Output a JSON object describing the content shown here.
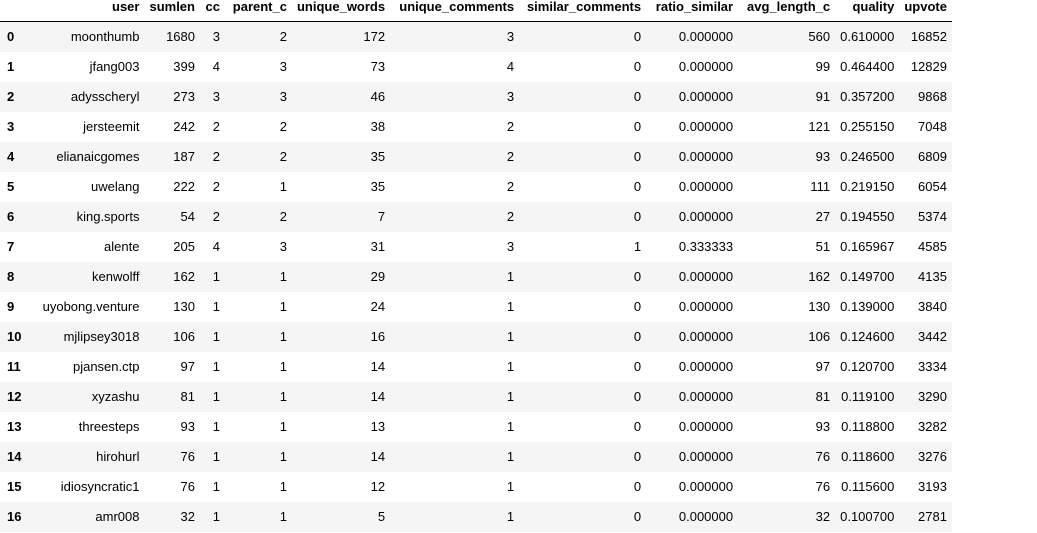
{
  "table": {
    "index_header": "",
    "columns": [
      "user",
      "sumlen",
      "cc",
      "parent_c",
      "unique_words",
      "unique_comments",
      "similar_comments",
      "ratio_similar",
      "avg_length_c",
      "quality",
      "upvote"
    ],
    "rows": [
      {
        "index": "0",
        "cells": [
          "moonthumb",
          "1680",
          "3",
          "2",
          "172",
          "3",
          "0",
          "0.000000",
          "560",
          "0.610000",
          "16852"
        ]
      },
      {
        "index": "1",
        "cells": [
          "jfang003",
          "399",
          "4",
          "3",
          "73",
          "4",
          "0",
          "0.000000",
          "99",
          "0.464400",
          "12829"
        ]
      },
      {
        "index": "2",
        "cells": [
          "adysscheryl",
          "273",
          "3",
          "3",
          "46",
          "3",
          "0",
          "0.000000",
          "91",
          "0.357200",
          "9868"
        ]
      },
      {
        "index": "3",
        "cells": [
          "jersteemit",
          "242",
          "2",
          "2",
          "38",
          "2",
          "0",
          "0.000000",
          "121",
          "0.255150",
          "7048"
        ]
      },
      {
        "index": "4",
        "cells": [
          "elianaicgomes",
          "187",
          "2",
          "2",
          "35",
          "2",
          "0",
          "0.000000",
          "93",
          "0.246500",
          "6809"
        ]
      },
      {
        "index": "5",
        "cells": [
          "uwelang",
          "222",
          "2",
          "1",
          "35",
          "2",
          "0",
          "0.000000",
          "111",
          "0.219150",
          "6054"
        ]
      },
      {
        "index": "6",
        "cells": [
          "king.sports",
          "54",
          "2",
          "2",
          "7",
          "2",
          "0",
          "0.000000",
          "27",
          "0.194550",
          "5374"
        ]
      },
      {
        "index": "7",
        "cells": [
          "alente",
          "205",
          "4",
          "3",
          "31",
          "3",
          "1",
          "0.333333",
          "51",
          "0.165967",
          "4585"
        ]
      },
      {
        "index": "8",
        "cells": [
          "kenwolff",
          "162",
          "1",
          "1",
          "29",
          "1",
          "0",
          "0.000000",
          "162",
          "0.149700",
          "4135"
        ]
      },
      {
        "index": "9",
        "cells": [
          "uyobong.venture",
          "130",
          "1",
          "1",
          "24",
          "1",
          "0",
          "0.000000",
          "130",
          "0.139000",
          "3840"
        ]
      },
      {
        "index": "10",
        "cells": [
          "mjlipsey3018",
          "106",
          "1",
          "1",
          "16",
          "1",
          "0",
          "0.000000",
          "106",
          "0.124600",
          "3442"
        ]
      },
      {
        "index": "11",
        "cells": [
          "pjansen.ctp",
          "97",
          "1",
          "1",
          "14",
          "1",
          "0",
          "0.000000",
          "97",
          "0.120700",
          "3334"
        ]
      },
      {
        "index": "12",
        "cells": [
          "xyzashu",
          "81",
          "1",
          "1",
          "14",
          "1",
          "0",
          "0.000000",
          "81",
          "0.119100",
          "3290"
        ]
      },
      {
        "index": "13",
        "cells": [
          "threesteps",
          "93",
          "1",
          "1",
          "13",
          "1",
          "0",
          "0.000000",
          "93",
          "0.118800",
          "3282"
        ]
      },
      {
        "index": "14",
        "cells": [
          "hirohurl",
          "76",
          "1",
          "1",
          "14",
          "1",
          "0",
          "0.000000",
          "76",
          "0.118600",
          "3276"
        ]
      },
      {
        "index": "15",
        "cells": [
          "idiosyncratic1",
          "76",
          "1",
          "1",
          "12",
          "1",
          "0",
          "0.000000",
          "76",
          "0.115600",
          "3193"
        ]
      },
      {
        "index": "16",
        "cells": [
          "amr008",
          "32",
          "1",
          "1",
          "5",
          "1",
          "0",
          "0.000000",
          "32",
          "0.100700",
          "2781"
        ]
      }
    ]
  }
}
